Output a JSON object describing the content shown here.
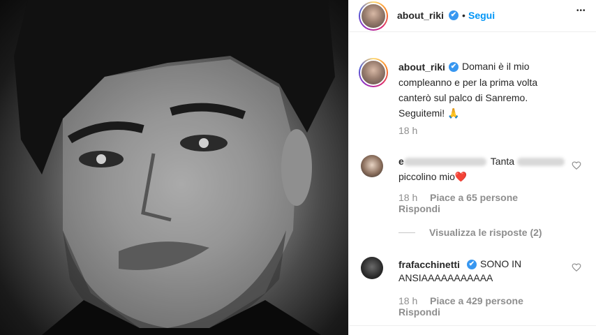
{
  "post": {
    "image_alt": "black and white portrait"
  },
  "header": {
    "username": "about_riki",
    "verified": "✔",
    "dot": "•",
    "follow_label": "Segui",
    "more": "•••"
  },
  "caption": {
    "username": "about_riki",
    "verified": "✔",
    "text_line1": "Domani è il mio",
    "text_line2": "compleanno e per la prima volta",
    "text_line3": "canterò sul palco di Sanremo.",
    "text_line4": "Seguitemi! 🙏",
    "time": "18 h"
  },
  "comments": [
    {
      "username_prefix": "e",
      "text_part": "Tanta",
      "text_line2": "piccolino mio❤️",
      "time": "18 h",
      "likes": "Piace a 65 persone",
      "reply": "Rispondi",
      "view_replies": "Visualizza le risposte (2)"
    },
    {
      "username": "frafacchinetti",
      "verified": "✔",
      "text_line1": "SONO IN",
      "text_line2": "ANSIAAAAAAAAAAA",
      "time": "18 h",
      "likes": "Piace a 429 persone",
      "reply": "Rispondi"
    }
  ],
  "colors": {
    "accent": "#0095f6",
    "verified": "#3897f0",
    "muted": "#8e8e8e",
    "text": "#262626"
  }
}
